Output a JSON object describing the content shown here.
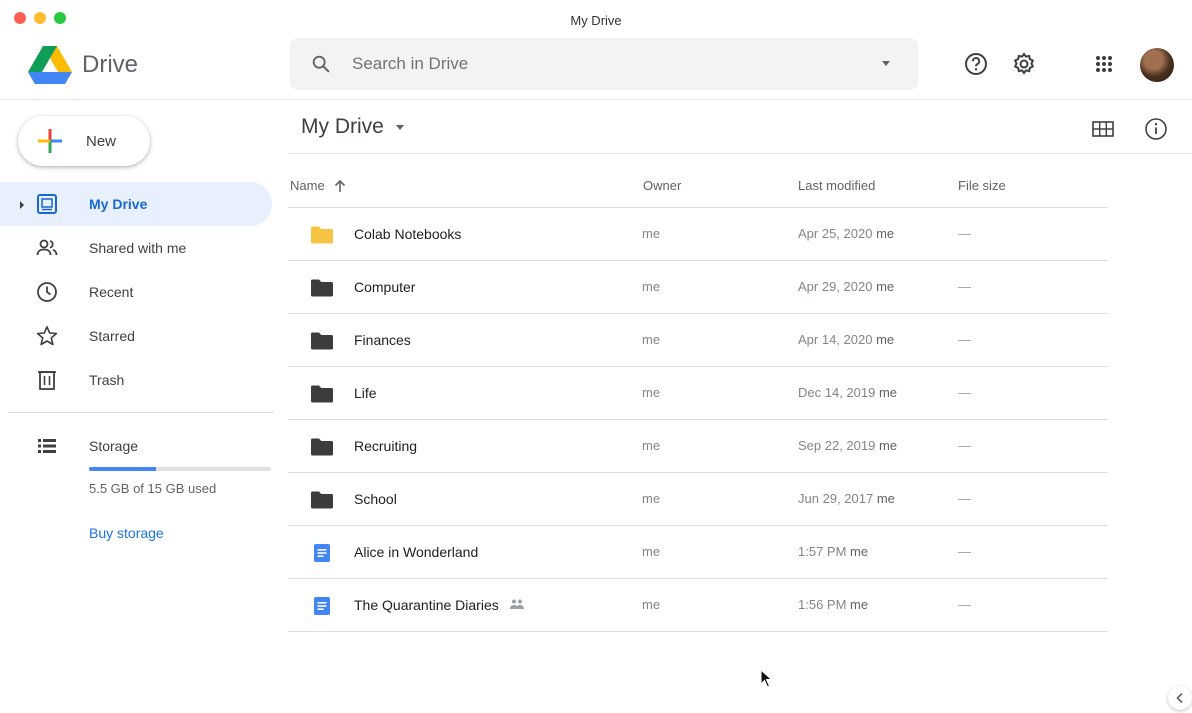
{
  "window": {
    "title": "My Drive"
  },
  "header": {
    "brand": "Drive",
    "search": {
      "placeholder": "Search in Drive"
    },
    "icons": [
      "drive-logo-icon",
      "search-icon",
      "dropdown-icon",
      "help-icon",
      "settings-icon",
      "apps-grid-icon",
      "account-avatar"
    ]
  },
  "sidebar": {
    "new_label": "New",
    "items": [
      {
        "label": "My Drive",
        "icon": "my-drive-icon",
        "active": true
      },
      {
        "label": "Shared with me",
        "icon": "shared-people-icon",
        "active": false
      },
      {
        "label": "Recent",
        "icon": "clock-icon",
        "active": false
      },
      {
        "label": "Starred",
        "icon": "star-icon",
        "active": false
      },
      {
        "label": "Trash",
        "icon": "trash-icon",
        "active": false
      }
    ],
    "storage": {
      "label": "Storage",
      "used_text": "5.5 GB of 15 GB used",
      "used_fraction": 0.367,
      "buy_label": "Buy storage"
    }
  },
  "main": {
    "breadcrumb": "My Drive",
    "columns": {
      "name": "Name",
      "owner": "Owner",
      "modified": "Last modified",
      "size": "File size"
    },
    "rows": [
      {
        "name": "Colab Notebooks",
        "type": "folder-yellow",
        "owner": "me",
        "modified": "Apr 25, 2020",
        "by": "me",
        "size": "—",
        "shared": false
      },
      {
        "name": "Computer",
        "type": "folder",
        "owner": "me",
        "modified": "Apr 29, 2020",
        "by": "me",
        "size": "—",
        "shared": false
      },
      {
        "name": "Finances",
        "type": "folder",
        "owner": "me",
        "modified": "Apr 14, 2020",
        "by": "me",
        "size": "—",
        "shared": false
      },
      {
        "name": "Life",
        "type": "folder",
        "owner": "me",
        "modified": "Dec 14, 2019",
        "by": "me",
        "size": "—",
        "shared": false
      },
      {
        "name": "Recruiting",
        "type": "folder",
        "owner": "me",
        "modified": "Sep 22, 2019",
        "by": "me",
        "size": "—",
        "shared": false
      },
      {
        "name": "School",
        "type": "folder",
        "owner": "me",
        "modified": "Jun 29, 2017",
        "by": "me",
        "size": "—",
        "shared": false
      },
      {
        "name": "Alice in Wonderland",
        "type": "doc",
        "owner": "me",
        "modified": "1:57 PM",
        "by": "me",
        "size": "—",
        "shared": false
      },
      {
        "name": "The Quarantine Diaries",
        "type": "doc",
        "owner": "me",
        "modified": "1:56 PM",
        "by": "me",
        "size": "—",
        "shared": true
      }
    ]
  },
  "colors": {
    "accent": "#1a73e8",
    "active_bg": "#e8f0fe",
    "folder_yellow": "#f6c342",
    "folder_dark": "#3c3c3c",
    "doc_blue": "#4285f4"
  }
}
